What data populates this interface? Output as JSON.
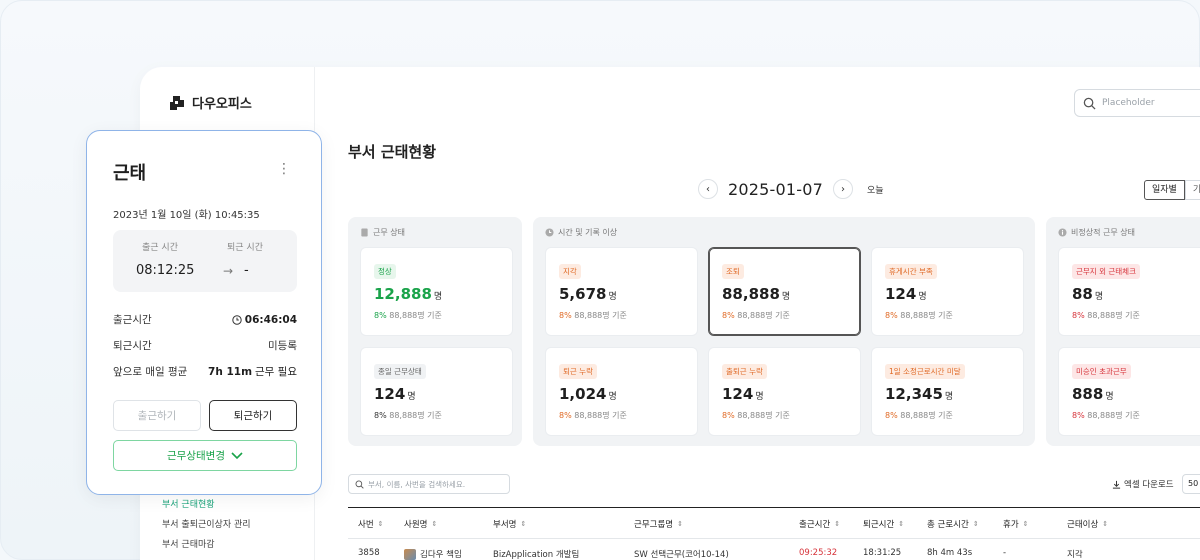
{
  "logo": {
    "name": "다우오피스"
  },
  "search": {
    "placeholder": "Placeholder"
  },
  "page": {
    "title": "부서 근태현황"
  },
  "date_nav": {
    "date": "2025-01-07",
    "today": "오늘",
    "prev": "‹",
    "next": "›"
  },
  "view_toggle": [
    "일자별",
    "기"
  ],
  "groups": [
    {
      "title": "근무 상태",
      "cards": [
        {
          "badge": "정상",
          "value": "12,888",
          "unit": "명",
          "pct": "8%",
          "base": "88,888명 기준",
          "tone": "green"
        },
        {
          "badge": "종일 근무상태",
          "value": "124",
          "unit": "명",
          "pct": "8%",
          "base": "88,888명 기준",
          "tone": "gray"
        }
      ]
    },
    {
      "title": "시간 및 기록 이상",
      "cards": [
        {
          "badge": "지각",
          "value": "5,678",
          "unit": "명",
          "pct": "8%",
          "base": "88,888명 기준",
          "tone": "orange"
        },
        {
          "badge": "조퇴",
          "value": "88,888",
          "unit": "명",
          "pct": "8%",
          "base": "88,888명 기준",
          "tone": "orange"
        },
        {
          "badge": "휴게시간 부족",
          "value": "124",
          "unit": "명",
          "pct": "8%",
          "base": "88,888명 기준",
          "tone": "orange"
        },
        {
          "badge": "퇴근 누락",
          "value": "1,024",
          "unit": "명",
          "pct": "8%",
          "base": "88,888명 기준",
          "tone": "orange"
        },
        {
          "badge": "출퇴근 누락",
          "value": "124",
          "unit": "명",
          "pct": "8%",
          "base": "88,888명 기준",
          "tone": "orange"
        },
        {
          "badge": "1일 소정근로시간 미달",
          "value": "12,345",
          "unit": "명",
          "pct": "8%",
          "base": "88,888명 기준",
          "tone": "orange"
        }
      ]
    },
    {
      "title": "비정상적 근무 상태",
      "cards": [
        {
          "badge": "근무지 외 근태체크",
          "value": "88",
          "unit": "명",
          "pct": "8%",
          "base": "88,888명 기준",
          "tone": "red"
        },
        {
          "badge": "미승인 초과근무",
          "value": "888",
          "unit": "명",
          "pct": "8%",
          "base": "88,888명 기준",
          "tone": "red"
        }
      ]
    }
  ],
  "table": {
    "search_placeholder": "부서, 이름, 사번을 검색하세요.",
    "excel": "엑셀 다운로드",
    "page_size": "50",
    "headers": [
      "사번",
      "사원명",
      "부서명",
      "근무그룹명",
      "출근시간",
      "퇴근시간",
      "총 근로시간",
      "휴가",
      "근태이상"
    ],
    "rows": [
      [
        "3858",
        "김다우 책임",
        "BizApplication 개발팀",
        "SW 선택근무(코어10-14)",
        "09:25:32",
        "18:31:25",
        "8h 4m 43s",
        "-",
        "지각"
      ]
    ]
  },
  "side_menu": [
    "부서 근태현황",
    "부서 출퇴근이상자 관리",
    "부서 근태마감"
  ],
  "attendance": {
    "title": "근태",
    "more": "⋮",
    "datetime": "2023년 1월 10일 (화) 10:45:35",
    "checkin_label": "출근 시간",
    "checkout_label": "퇴근 시간",
    "checkin_value": "08:12:25",
    "checkout_value": "-",
    "rows": [
      {
        "label": "출근시간",
        "value": "06:46:04"
      },
      {
        "label": "퇴근시간",
        "value": "미등록"
      },
      {
        "label": "앞으로 매일 평균",
        "value_bold": "7h 11m",
        "value_rest": " 근무 필요"
      }
    ],
    "btn_checkin": "출근하기",
    "btn_checkout": "퇴근하기",
    "btn_status": "근무상태변경"
  },
  "colors": {
    "accent_green": "#1aa34a",
    "accent_orange": "#e06a26",
    "accent_red": "#d6333a",
    "card_border": "#8fb4e8"
  }
}
